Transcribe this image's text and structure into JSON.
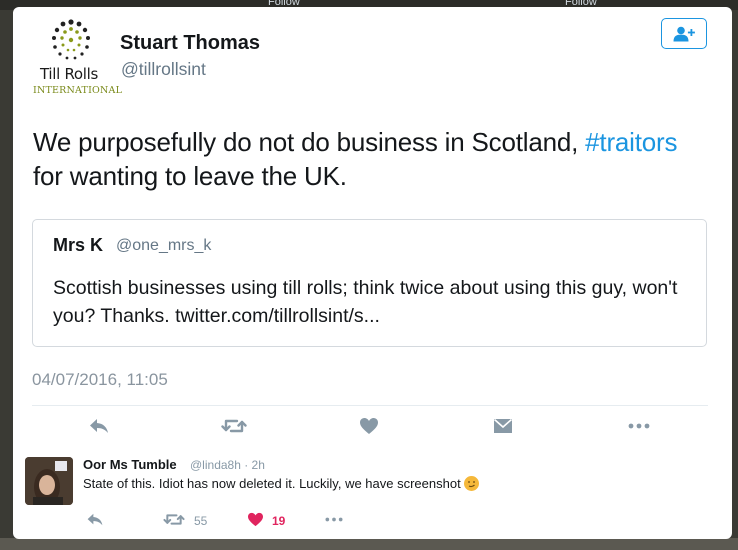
{
  "background": {
    "follow_label": "Follow"
  },
  "tweet": {
    "name": "Stuart Thomas",
    "handle": "@tillrollsint",
    "logo": {
      "line1": "Till Rolls",
      "line2": "INTERNATIONAL"
    },
    "text_before": "We purposefully do not do business in Scotland, ",
    "hashtag": "#traitors",
    "text_after": " for wanting to leave the UK.",
    "timestamp": "04/07/2016, 11:05",
    "follow_icon": "add-user-icon",
    "accent_color": "#1b95e0"
  },
  "quoted": {
    "name": "Mrs K",
    "handle": "@one_mrs_k",
    "text": "Scottish businesses using till rolls; think twice about using this guy, won't you? Thanks.  twitter.com/tillrollsint/s..."
  },
  "actions": [
    "reply-icon",
    "retweet-icon",
    "like-icon",
    "direct-message-icon",
    "more-icon"
  ],
  "reply": {
    "name": "Oor Ms Tumble",
    "handle": "@linda8h · 2h",
    "text": "State of this.  Idiot has now deleted it. Luckily, we have screenshot",
    "retweets": "55",
    "likes": "19",
    "like_color": "#e0245e"
  }
}
